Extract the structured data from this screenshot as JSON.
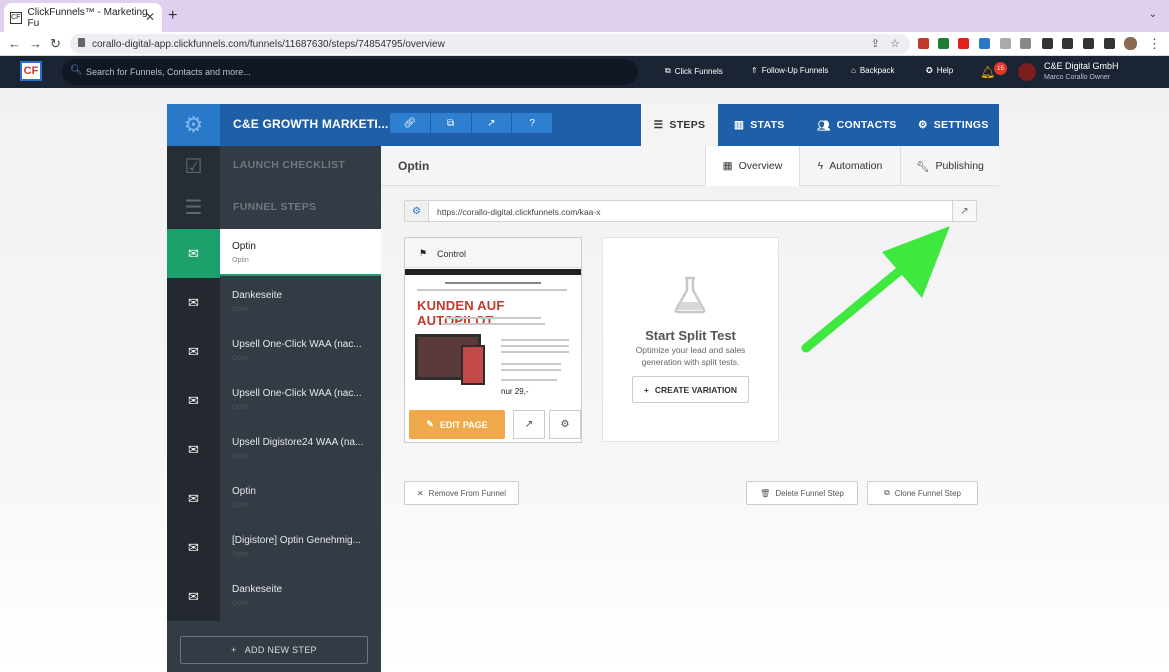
{
  "browser": {
    "tab_title": "ClickFunnels™ - Marketing Fu",
    "new_tab": "+",
    "url": "corallo-digital-app.clickfunnels.com/funnels/11687630/steps/74854795/overview"
  },
  "topnav": {
    "search_placeholder": "Search for Funnels, Contacts and more...",
    "links": [
      "Click Funnels",
      "Follow-Up Funnels",
      "Backpack",
      "Help"
    ],
    "notification_count": "15",
    "account_name": "C&E Digital GmbH",
    "account_user": "Marco Corallo   Owner"
  },
  "funnel": {
    "title": "C&E GROWTH MARKETI...",
    "tabs": [
      "STEPS",
      "STATS",
      "CONTACTS",
      "SETTINGS"
    ]
  },
  "sidebar": {
    "launch_checklist": "LAUNCH CHECKLIST",
    "funnel_steps": "FUNNEL STEPS",
    "steps": [
      {
        "name": "Optin",
        "sub": "Optin"
      },
      {
        "name": "Dankeseite",
        "sub": "Optin"
      },
      {
        "name": "Upsell One-Click WAA (nac...",
        "sub": "Optin"
      },
      {
        "name": "Upsell One-Click WAA (nac...",
        "sub": "Optin"
      },
      {
        "name": "Upsell Digistore24 WAA (na...",
        "sub": "Optin"
      },
      {
        "name": "Optin",
        "sub": "Optin"
      },
      {
        "name": "[Digistore] Optin Genehmig...",
        "sub": "Optin"
      },
      {
        "name": "Dankeseite",
        "sub": "Optin"
      }
    ],
    "add_step": "ADD NEW STEP"
  },
  "content": {
    "title": "Optin",
    "tabs": [
      "Overview",
      "Automation",
      "Publishing"
    ],
    "page_url": "https://corallo-digital.clickfunnels.com/kaa-x",
    "control_label": "Control",
    "thumb_headline": "KUNDEN AUF AUTOPILOT",
    "thumb_price": "nur 29,-",
    "edit_page": "EDIT PAGE",
    "split_title": "Start Split Test",
    "split_desc": "Optimize your lead and sales generation with split tests.",
    "create_variation": "CREATE VARIATION",
    "remove_funnel": "Remove From Funnel",
    "delete_step": "Delete Funnel Step",
    "clone_step": "Clone Funnel Step"
  },
  "colors": {
    "funnel_header": "#1f5fa8",
    "sidebar": "#333b44",
    "active_step": "#1ba06c",
    "edit_button": "#f0a94a",
    "annotation_arrow": "#3ee83e"
  }
}
